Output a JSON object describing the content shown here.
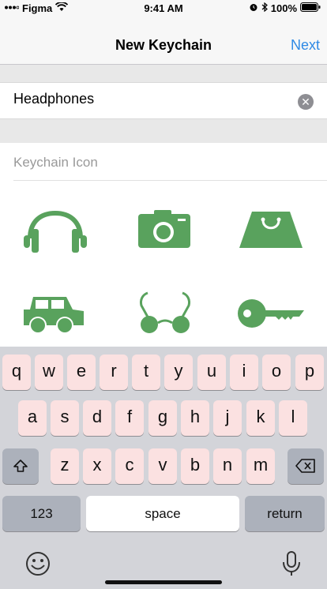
{
  "status_bar": {
    "carrier": "Figma",
    "time": "9:41 AM",
    "battery": "100%"
  },
  "nav": {
    "title": "New Keychain",
    "next_label": "Next"
  },
  "name_field": {
    "value": "Headphones"
  },
  "icons_section": {
    "label": "Keychain Icon"
  },
  "icons": [
    "headphones-icon",
    "camera-icon",
    "shopping-bag-icon",
    "car-icon",
    "glasses-icon",
    "key-icon"
  ],
  "icon_color": "#59a25d",
  "keyboard": {
    "row1": [
      "q",
      "w",
      "e",
      "r",
      "t",
      "y",
      "u",
      "i",
      "o",
      "p"
    ],
    "row2": [
      "a",
      "s",
      "d",
      "f",
      "g",
      "h",
      "j",
      "k",
      "l"
    ],
    "row3": [
      "z",
      "x",
      "c",
      "v",
      "b",
      "n",
      "m"
    ],
    "numbers_label": "123",
    "space_label": "space",
    "return_label": "return",
    "key_color": "#fbe1e1"
  }
}
